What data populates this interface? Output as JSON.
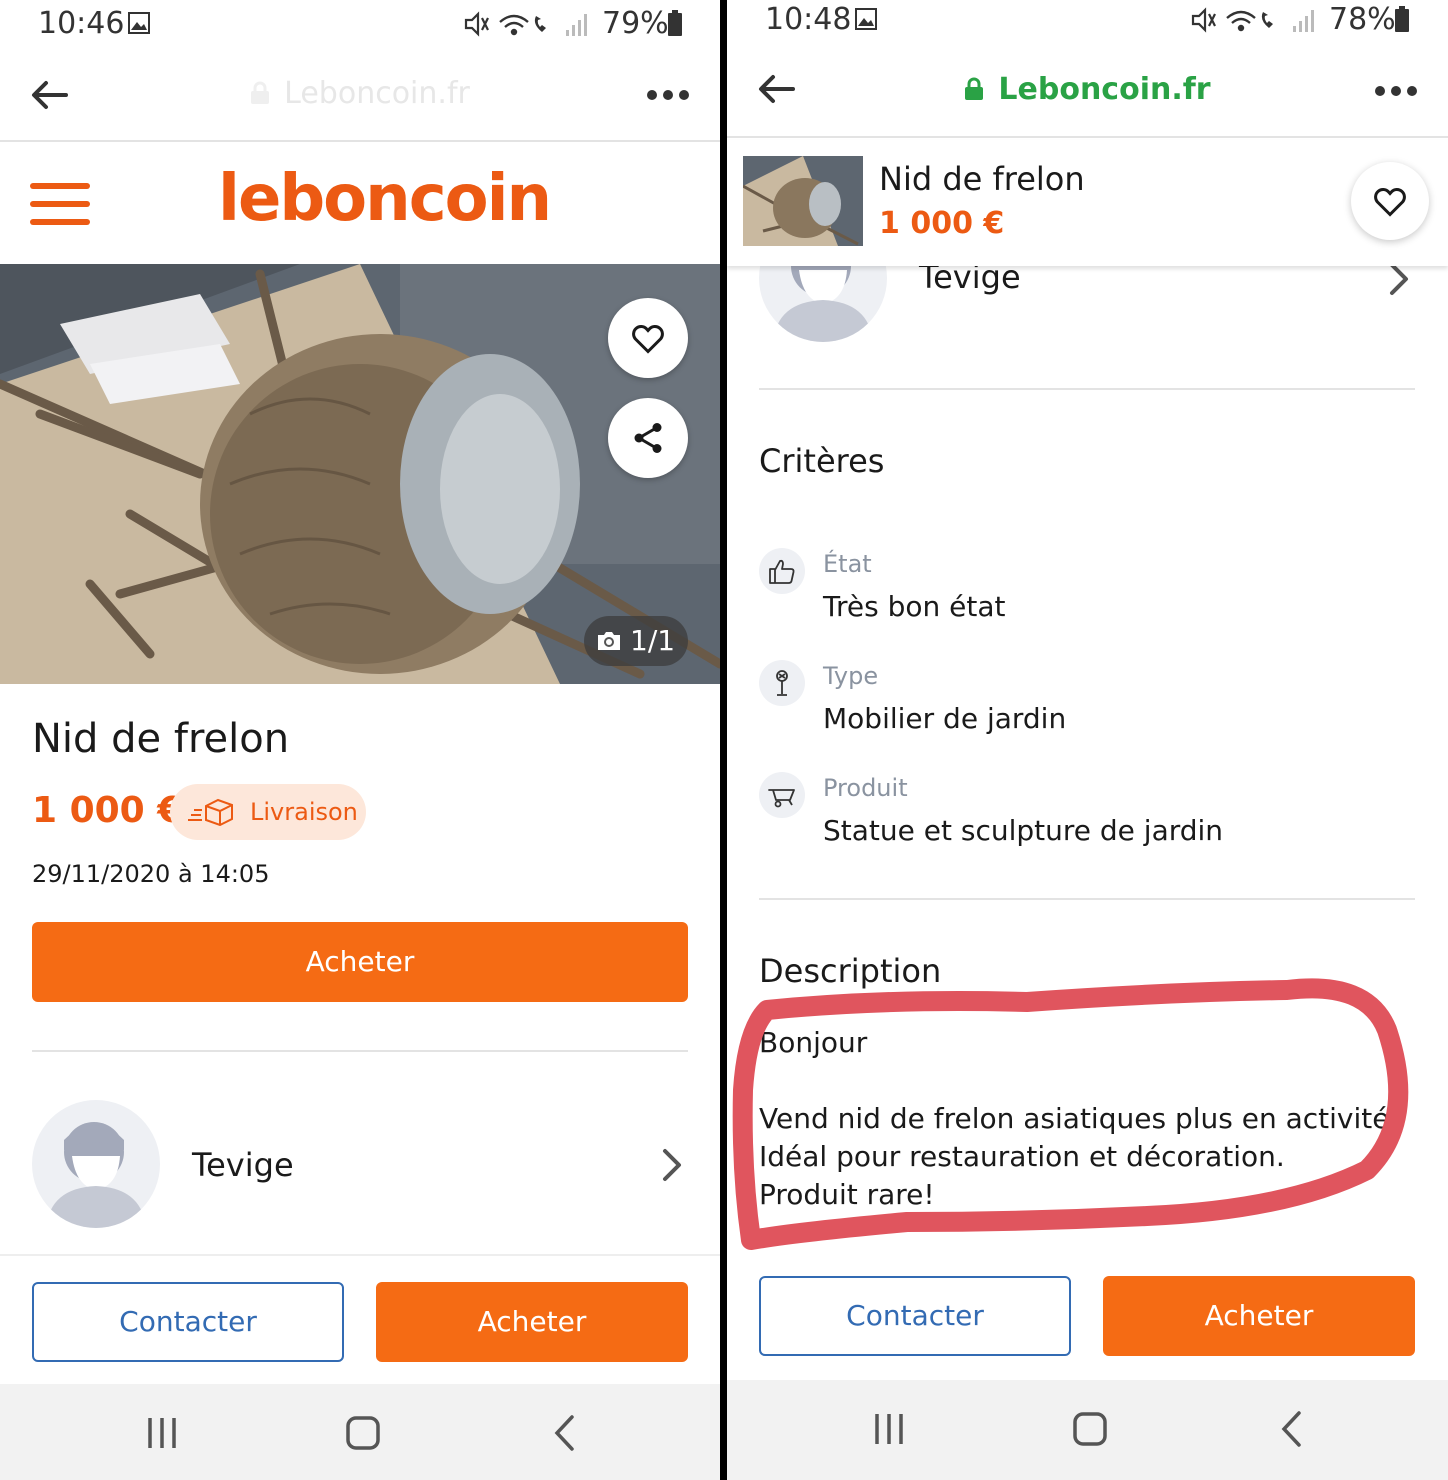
{
  "left": {
    "status": {
      "time": "10:46",
      "battery": "79%"
    },
    "url": {
      "domain": "Leboncoin.fr"
    },
    "header": {
      "logo": "leboncoin"
    },
    "photo": {
      "counter": "1/1"
    },
    "ad": {
      "title": "Nid de frelon",
      "price": "1 000 €",
      "delivery_label": "Livraison",
      "date": "29/11/2020 à 14:05",
      "buy_label": "Acheter"
    },
    "seller": {
      "name": "Tevige"
    },
    "bottom": {
      "contact_label": "Contacter",
      "buy_label": "Acheter"
    }
  },
  "right": {
    "status": {
      "time": "10:48",
      "battery": "78%"
    },
    "url": {
      "domain": "Leboncoin.fr"
    },
    "sticky": {
      "title": "Nid de frelon",
      "price": "1 000 €"
    },
    "seller": {
      "name": "Tevige"
    },
    "criteria": {
      "title": "Critères",
      "items": [
        {
          "label": "État",
          "value": "Très bon état",
          "icon": "thumbs-up-icon"
        },
        {
          "label": "Type",
          "value": "Mobilier de jardin",
          "icon": "garden-lamp-icon"
        },
        {
          "label": "Produit",
          "value": "Statue et sculpture de jardin",
          "icon": "wheelbarrow-icon"
        }
      ]
    },
    "description": {
      "title": "Description",
      "lines": [
        "Bonjour",
        "",
        "Vend nid de frelon asiatiques plus en activité.",
        "Idéal pour restauration et décoration.",
        "Produit rare!"
      ]
    },
    "bottom": {
      "contact_label": "Contacter",
      "buy_label": "Acheter"
    }
  },
  "colors": {
    "brand": "#ec5a13",
    "button": "#f56b14",
    "link": "#336bb3",
    "secure": "#2aa245",
    "highlight": "#e0555e"
  }
}
